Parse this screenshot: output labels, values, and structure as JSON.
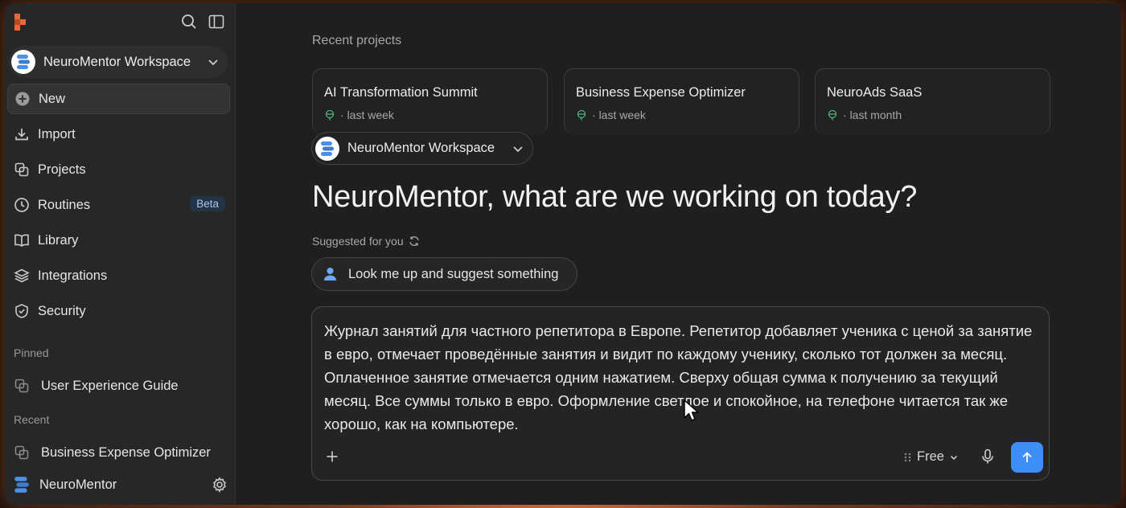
{
  "sidebar": {
    "workspace_name": "NeuroMentor Workspace",
    "nav": [
      {
        "label": "New",
        "icon": "plus-circle-icon"
      },
      {
        "label": "Import",
        "icon": "download-icon"
      },
      {
        "label": "Projects",
        "icon": "projects-icon"
      },
      {
        "label": "Routines",
        "icon": "clock-icon",
        "badge": "Beta"
      },
      {
        "label": "Library",
        "icon": "book-icon"
      },
      {
        "label": "Integrations",
        "icon": "layers-icon"
      },
      {
        "label": "Security",
        "icon": "shield-icon"
      }
    ],
    "pinned_label": "Pinned",
    "pinned": [
      {
        "label": "User Experience Guide"
      }
    ],
    "recent_label": "Recent",
    "recent": [
      {
        "label": "Business Expense Optimizer"
      }
    ],
    "user_name": "NeuroMentor"
  },
  "main": {
    "recent_projects_title": "Recent projects",
    "projects": [
      {
        "name": "AI Transformation Summit",
        "meta": "last week"
      },
      {
        "name": "Business Expense Optimizer",
        "meta": "last week"
      },
      {
        "name": "NeuroAds SaaS",
        "meta": "last month"
      }
    ],
    "workspace_pill": "NeuroMentor Workspace",
    "headline": "NeuroMentor, what are we working on today?",
    "suggested_label": "Suggested for you",
    "suggestion_chip": "Look me up and suggest something",
    "composer_text": "Журнал занятий для частного репетитора в Европе. Репетитор добавляет ученика с ценой за занятие в евро, отмечает проведённые занятия и видит по каждому ученику, сколько тот должен за месяц. Оплаченное занятие отмечается одним нажатием. Сверху общая сумма к получению за текущий месяц. Все суммы только в евро. Оформление светлое и спокойное, на телефоне читается так же хорошо, как на компьютере.",
    "model_label": "Free"
  },
  "colors": {
    "accent": "#3d8ef7",
    "beta_bg": "#243447",
    "globe": "#4fb37a",
    "logo": "#f0663a"
  }
}
